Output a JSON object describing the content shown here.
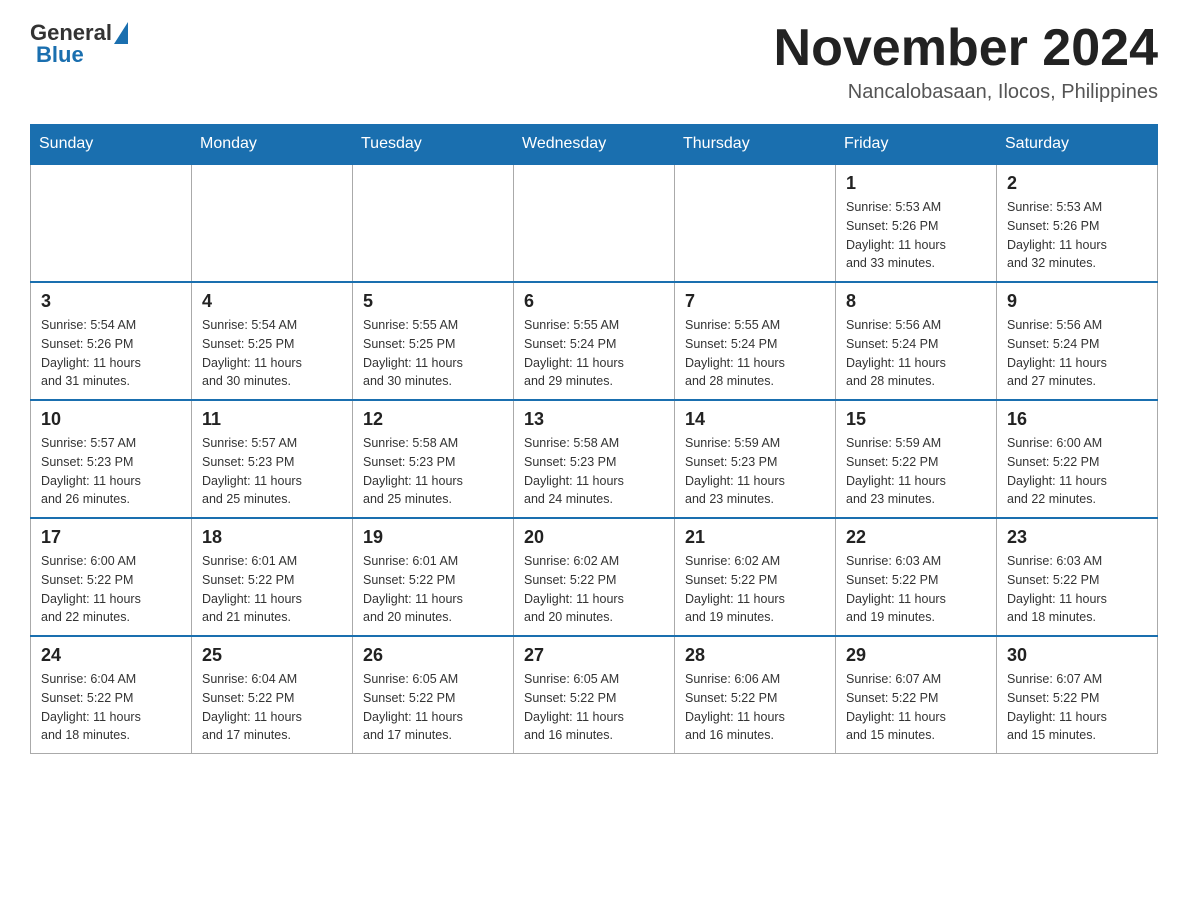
{
  "header": {
    "logo_general": "General",
    "logo_blue": "Blue",
    "month_title": "November 2024",
    "location": "Nancalobasaan, Ilocos, Philippines"
  },
  "weekdays": [
    "Sunday",
    "Monday",
    "Tuesday",
    "Wednesday",
    "Thursday",
    "Friday",
    "Saturday"
  ],
  "weeks": [
    [
      {
        "day": "",
        "info": ""
      },
      {
        "day": "",
        "info": ""
      },
      {
        "day": "",
        "info": ""
      },
      {
        "day": "",
        "info": ""
      },
      {
        "day": "",
        "info": ""
      },
      {
        "day": "1",
        "info": "Sunrise: 5:53 AM\nSunset: 5:26 PM\nDaylight: 11 hours\nand 33 minutes."
      },
      {
        "day": "2",
        "info": "Sunrise: 5:53 AM\nSunset: 5:26 PM\nDaylight: 11 hours\nand 32 minutes."
      }
    ],
    [
      {
        "day": "3",
        "info": "Sunrise: 5:54 AM\nSunset: 5:26 PM\nDaylight: 11 hours\nand 31 minutes."
      },
      {
        "day": "4",
        "info": "Sunrise: 5:54 AM\nSunset: 5:25 PM\nDaylight: 11 hours\nand 30 minutes."
      },
      {
        "day": "5",
        "info": "Sunrise: 5:55 AM\nSunset: 5:25 PM\nDaylight: 11 hours\nand 30 minutes."
      },
      {
        "day": "6",
        "info": "Sunrise: 5:55 AM\nSunset: 5:24 PM\nDaylight: 11 hours\nand 29 minutes."
      },
      {
        "day": "7",
        "info": "Sunrise: 5:55 AM\nSunset: 5:24 PM\nDaylight: 11 hours\nand 28 minutes."
      },
      {
        "day": "8",
        "info": "Sunrise: 5:56 AM\nSunset: 5:24 PM\nDaylight: 11 hours\nand 28 minutes."
      },
      {
        "day": "9",
        "info": "Sunrise: 5:56 AM\nSunset: 5:24 PM\nDaylight: 11 hours\nand 27 minutes."
      }
    ],
    [
      {
        "day": "10",
        "info": "Sunrise: 5:57 AM\nSunset: 5:23 PM\nDaylight: 11 hours\nand 26 minutes."
      },
      {
        "day": "11",
        "info": "Sunrise: 5:57 AM\nSunset: 5:23 PM\nDaylight: 11 hours\nand 25 minutes."
      },
      {
        "day": "12",
        "info": "Sunrise: 5:58 AM\nSunset: 5:23 PM\nDaylight: 11 hours\nand 25 minutes."
      },
      {
        "day": "13",
        "info": "Sunrise: 5:58 AM\nSunset: 5:23 PM\nDaylight: 11 hours\nand 24 minutes."
      },
      {
        "day": "14",
        "info": "Sunrise: 5:59 AM\nSunset: 5:23 PM\nDaylight: 11 hours\nand 23 minutes."
      },
      {
        "day": "15",
        "info": "Sunrise: 5:59 AM\nSunset: 5:22 PM\nDaylight: 11 hours\nand 23 minutes."
      },
      {
        "day": "16",
        "info": "Sunrise: 6:00 AM\nSunset: 5:22 PM\nDaylight: 11 hours\nand 22 minutes."
      }
    ],
    [
      {
        "day": "17",
        "info": "Sunrise: 6:00 AM\nSunset: 5:22 PM\nDaylight: 11 hours\nand 22 minutes."
      },
      {
        "day": "18",
        "info": "Sunrise: 6:01 AM\nSunset: 5:22 PM\nDaylight: 11 hours\nand 21 minutes."
      },
      {
        "day": "19",
        "info": "Sunrise: 6:01 AM\nSunset: 5:22 PM\nDaylight: 11 hours\nand 20 minutes."
      },
      {
        "day": "20",
        "info": "Sunrise: 6:02 AM\nSunset: 5:22 PM\nDaylight: 11 hours\nand 20 minutes."
      },
      {
        "day": "21",
        "info": "Sunrise: 6:02 AM\nSunset: 5:22 PM\nDaylight: 11 hours\nand 19 minutes."
      },
      {
        "day": "22",
        "info": "Sunrise: 6:03 AM\nSunset: 5:22 PM\nDaylight: 11 hours\nand 19 minutes."
      },
      {
        "day": "23",
        "info": "Sunrise: 6:03 AM\nSunset: 5:22 PM\nDaylight: 11 hours\nand 18 minutes."
      }
    ],
    [
      {
        "day": "24",
        "info": "Sunrise: 6:04 AM\nSunset: 5:22 PM\nDaylight: 11 hours\nand 18 minutes."
      },
      {
        "day": "25",
        "info": "Sunrise: 6:04 AM\nSunset: 5:22 PM\nDaylight: 11 hours\nand 17 minutes."
      },
      {
        "day": "26",
        "info": "Sunrise: 6:05 AM\nSunset: 5:22 PM\nDaylight: 11 hours\nand 17 minutes."
      },
      {
        "day": "27",
        "info": "Sunrise: 6:05 AM\nSunset: 5:22 PM\nDaylight: 11 hours\nand 16 minutes."
      },
      {
        "day": "28",
        "info": "Sunrise: 6:06 AM\nSunset: 5:22 PM\nDaylight: 11 hours\nand 16 minutes."
      },
      {
        "day": "29",
        "info": "Sunrise: 6:07 AM\nSunset: 5:22 PM\nDaylight: 11 hours\nand 15 minutes."
      },
      {
        "day": "30",
        "info": "Sunrise: 6:07 AM\nSunset: 5:22 PM\nDaylight: 11 hours\nand 15 minutes."
      }
    ]
  ]
}
